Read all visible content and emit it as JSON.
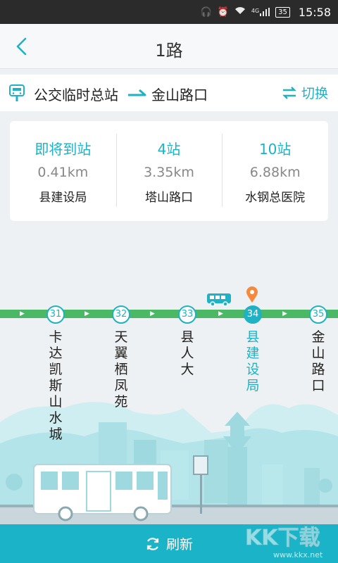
{
  "status_bar": {
    "time": "15:58",
    "battery": "35",
    "network": "4G"
  },
  "header": {
    "title": "1路",
    "back_icon": "back-chevron-icon"
  },
  "route": {
    "from": "公交临时总站",
    "to": "金山路口",
    "switch_label": "切换"
  },
  "arrivals": [
    {
      "status": "即将到站",
      "distance": "0.41km",
      "stop": "县建设局"
    },
    {
      "status": "4站",
      "distance": "3.35km",
      "stop": "塔山路口"
    },
    {
      "status": "10站",
      "distance": "6.88km",
      "stop": "水钢总医院"
    }
  ],
  "stops": [
    {
      "number": "31",
      "name": "卡达凯斯山水城"
    },
    {
      "number": "32",
      "name": "天翼栖凤苑"
    },
    {
      "number": "33",
      "name": "县人大"
    },
    {
      "number": "34",
      "name": "县建设局",
      "current": true
    },
    {
      "number": "35",
      "name": "金山路口"
    }
  ],
  "refresh_label": "刷新",
  "colors": {
    "accent": "#1fb1c4",
    "line": "#4ab865",
    "refresh_bar": "#1ab3c7"
  },
  "watermark": {
    "brand": "KK下载",
    "site": "www.kkx.net"
  }
}
